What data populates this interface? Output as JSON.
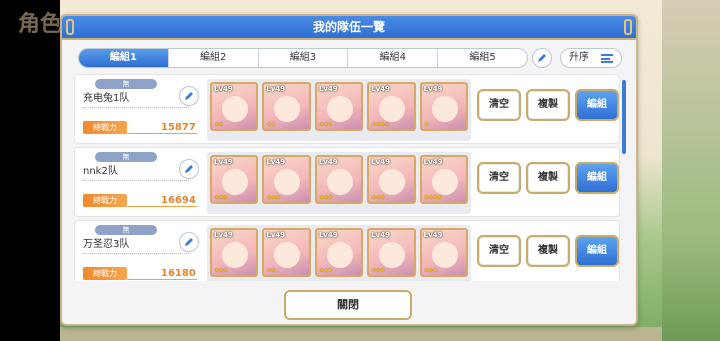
{
  "background": {
    "title": "角色"
  },
  "modal": {
    "title": "我的隊伍一覽",
    "tabs": [
      {
        "label": "編組1",
        "active": true
      },
      {
        "label": "編組2",
        "active": false
      },
      {
        "label": "編組3",
        "active": false
      },
      {
        "label": "編組4",
        "active": false
      },
      {
        "label": "編組5",
        "active": false
      }
    ],
    "sort_label": "升序",
    "close_label": "關閉"
  },
  "teams": [
    {
      "tag": "無",
      "name": "充电兔1队",
      "power_label": "總戰力",
      "power": "15877",
      "units": [
        {
          "lv": "Lv49",
          "stars": "★★"
        },
        {
          "lv": "Lv49",
          "stars": "★★"
        },
        {
          "lv": "Lv49",
          "stars": "★★★"
        },
        {
          "lv": "Lv49",
          "stars": "★★★★"
        },
        {
          "lv": "Lv49",
          "stars": "★"
        }
      ],
      "buttons": {
        "clear": "清空",
        "copy": "複製",
        "edit": "編組"
      }
    },
    {
      "tag": "無",
      "name": "nnk2队",
      "power_label": "總戰力",
      "power": "16694",
      "units": [
        {
          "lv": "Lv49",
          "stars": "★★★"
        },
        {
          "lv": "Lv49",
          "stars": "★★★"
        },
        {
          "lv": "Lv49",
          "stars": "★★★"
        },
        {
          "lv": "Lv49",
          "stars": "★★★"
        },
        {
          "lv": "Lv49",
          "stars": "★★★★"
        }
      ],
      "buttons": {
        "clear": "清空",
        "copy": "複製",
        "edit": "編組"
      }
    },
    {
      "tag": "無",
      "name": "万圣忍3队",
      "power_label": "總戰力",
      "power": "16180",
      "units": [
        {
          "lv": "Lv49",
          "stars": "★★★"
        },
        {
          "lv": "Lv49",
          "stars": "★★"
        },
        {
          "lv": "Lv49",
          "stars": "★★★"
        },
        {
          "lv": "Lv49",
          "stars": "★★★"
        },
        {
          "lv": "Lv49",
          "stars": "★★★"
        }
      ],
      "buttons": {
        "clear": "清空",
        "copy": "複製",
        "edit": "編組"
      }
    }
  ],
  "colors": {
    "header_blue": "#2f6fd3",
    "power_orange": "#e8852b",
    "border_gold": "#c9ab6a"
  }
}
